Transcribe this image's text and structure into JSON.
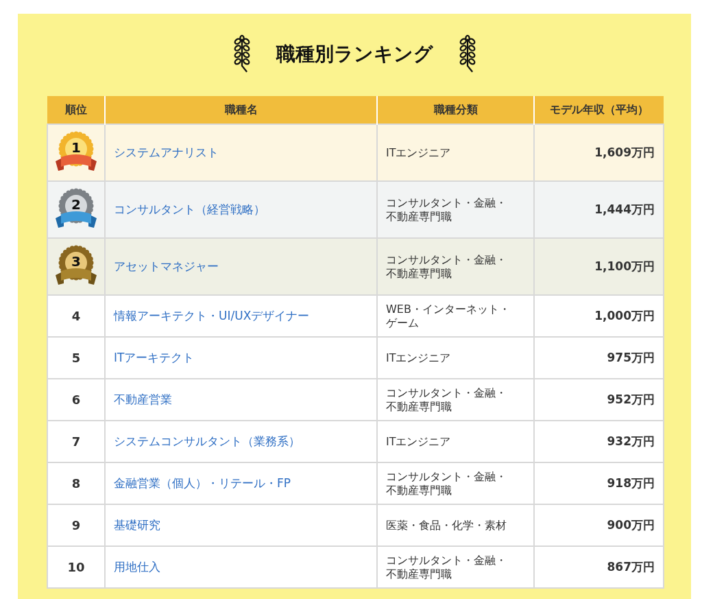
{
  "title": "職種別ランキング",
  "table": {
    "columns": [
      "順位",
      "職種名",
      "職種分類",
      "モデル年収（平均）"
    ],
    "rows": [
      {
        "kind": "gold",
        "rank": "1",
        "name": "システムアナリスト",
        "category": "ITエンジニア",
        "salary": "1,609万円"
      },
      {
        "kind": "silver",
        "rank": "2",
        "name": "コンサルタント（経営戦略）",
        "category": "コンサルタント・金融・不動産専門職",
        "salary": "1,444万円"
      },
      {
        "kind": "bronze",
        "rank": "3",
        "name": "アセットマネジャー",
        "category": "コンサルタント・金融・不動産専門職",
        "salary": "1,100万円"
      },
      {
        "kind": "plain",
        "rank": "4",
        "name": "情報アーキテクト・UI/UXデザイナー",
        "category": "WEB・インターネット・ゲーム",
        "salary": "1,000万円"
      },
      {
        "kind": "plain",
        "rank": "5",
        "name": "ITアーキテクト",
        "category": "ITエンジニア",
        "salary": "975万円"
      },
      {
        "kind": "plain",
        "rank": "6",
        "name": "不動産営業",
        "category": "コンサルタント・金融・不動産専門職",
        "salary": "952万円"
      },
      {
        "kind": "plain",
        "rank": "7",
        "name": "システムコンサルタント（業務系）",
        "category": "ITエンジニア",
        "salary": "932万円"
      },
      {
        "kind": "plain",
        "rank": "8",
        "name": "金融営業（個人）・リテール・FP",
        "category": "コンサルタント・金融・不動産専門職",
        "salary": "918万円"
      },
      {
        "kind": "plain",
        "rank": "9",
        "name": "基礎研究",
        "category": "医薬・食品・化学・素材",
        "salary": "900万円"
      },
      {
        "kind": "plain",
        "rank": "10",
        "name": "用地仕入",
        "category": "コンサルタント・金融・不動産専門職",
        "salary": "867万円"
      }
    ]
  }
}
